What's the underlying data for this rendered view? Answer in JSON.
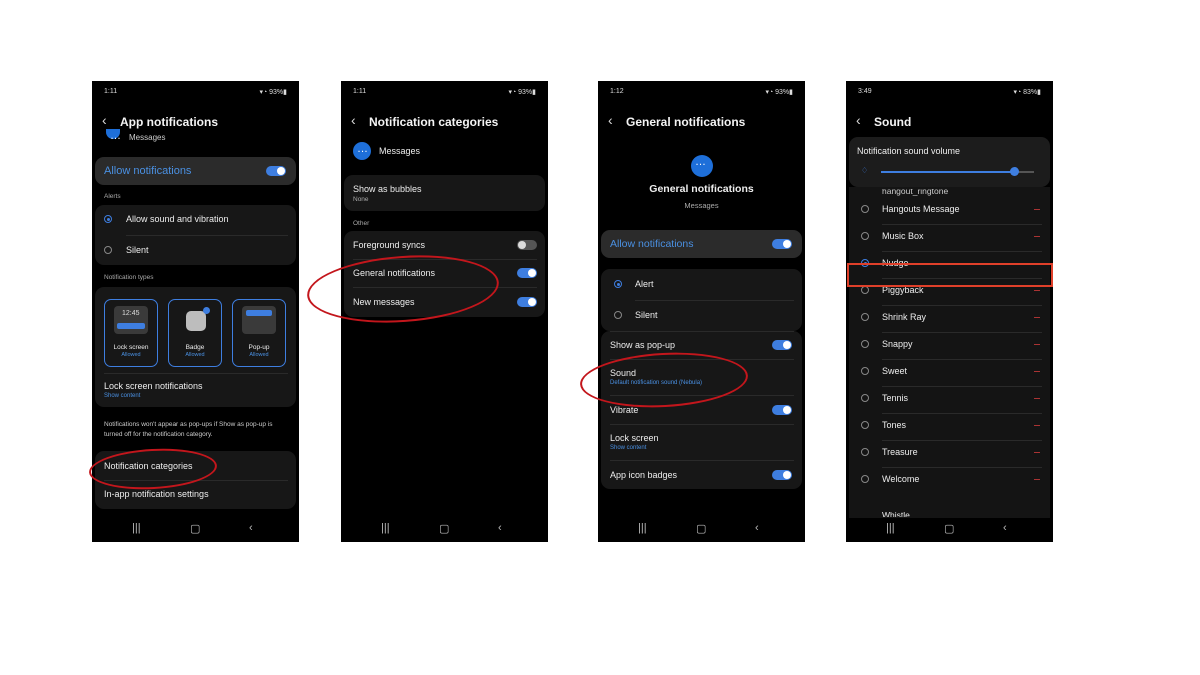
{
  "status": {
    "p1": {
      "time": "1:11",
      "battery": "93%"
    },
    "p2": {
      "time": "1:11",
      "battery": "93%"
    },
    "p3": {
      "time": "1:12",
      "battery": "93%"
    },
    "p4": {
      "time": "3:49",
      "battery": "83%"
    }
  },
  "screen1": {
    "title": "App notifications",
    "app_name": "Messages",
    "allow": "Allow notifications",
    "alerts_header": "Alerts",
    "alert_options": [
      "Allow sound and vibration",
      "Silent"
    ],
    "types_header": "Notification types",
    "types": [
      {
        "label": "Lock screen",
        "status": "Allowed",
        "time": "12:45"
      },
      {
        "label": "Badge",
        "status": "Allowed"
      },
      {
        "label": "Pop-up",
        "status": "Allowed"
      }
    ],
    "lock_title": "Lock screen notifications",
    "lock_sub": "Show content",
    "note": "Notifications won't appear as pop-ups if Show as pop-up is turned off for the notification category.",
    "categories": "Notification categories",
    "inapp": "In-app notification settings"
  },
  "screen2": {
    "title": "Notification categories",
    "app_name": "Messages",
    "bubbles_title": "Show as bubbles",
    "bubbles_sub": "None",
    "other_header": "Other",
    "rows": [
      "Foreground syncs",
      "General notifications",
      "New messages"
    ]
  },
  "screen3": {
    "title": "General notifications",
    "hero_title": "General notifications",
    "hero_sub": "Messages",
    "allow": "Allow notifications",
    "alert": "Alert",
    "silent": "Silent",
    "popup": "Show as pop-up",
    "sound_title": "Sound",
    "sound_sub": "Default notification sound (Nebula)",
    "vibrate": "Vibrate",
    "lock_title": "Lock screen",
    "lock_sub": "Show content",
    "badges": "App icon badges"
  },
  "screen4": {
    "title": "Sound",
    "volume_label": "Notification sound volume",
    "volume_level": 0.87,
    "sounds": [
      "Hangouts Message",
      "Music Box",
      "Nudge",
      "Piggyback",
      "Shrink Ray",
      "Snappy",
      "Sweet",
      "Tennis",
      "Tones",
      "Treasure",
      "Welcome"
    ],
    "partial_top": "hangout_ringtone",
    "partial_bottom": "Whistle",
    "selected": "Nudge"
  },
  "colors": {
    "accent": "#3e7ee0",
    "highlight": "#c3161c"
  }
}
